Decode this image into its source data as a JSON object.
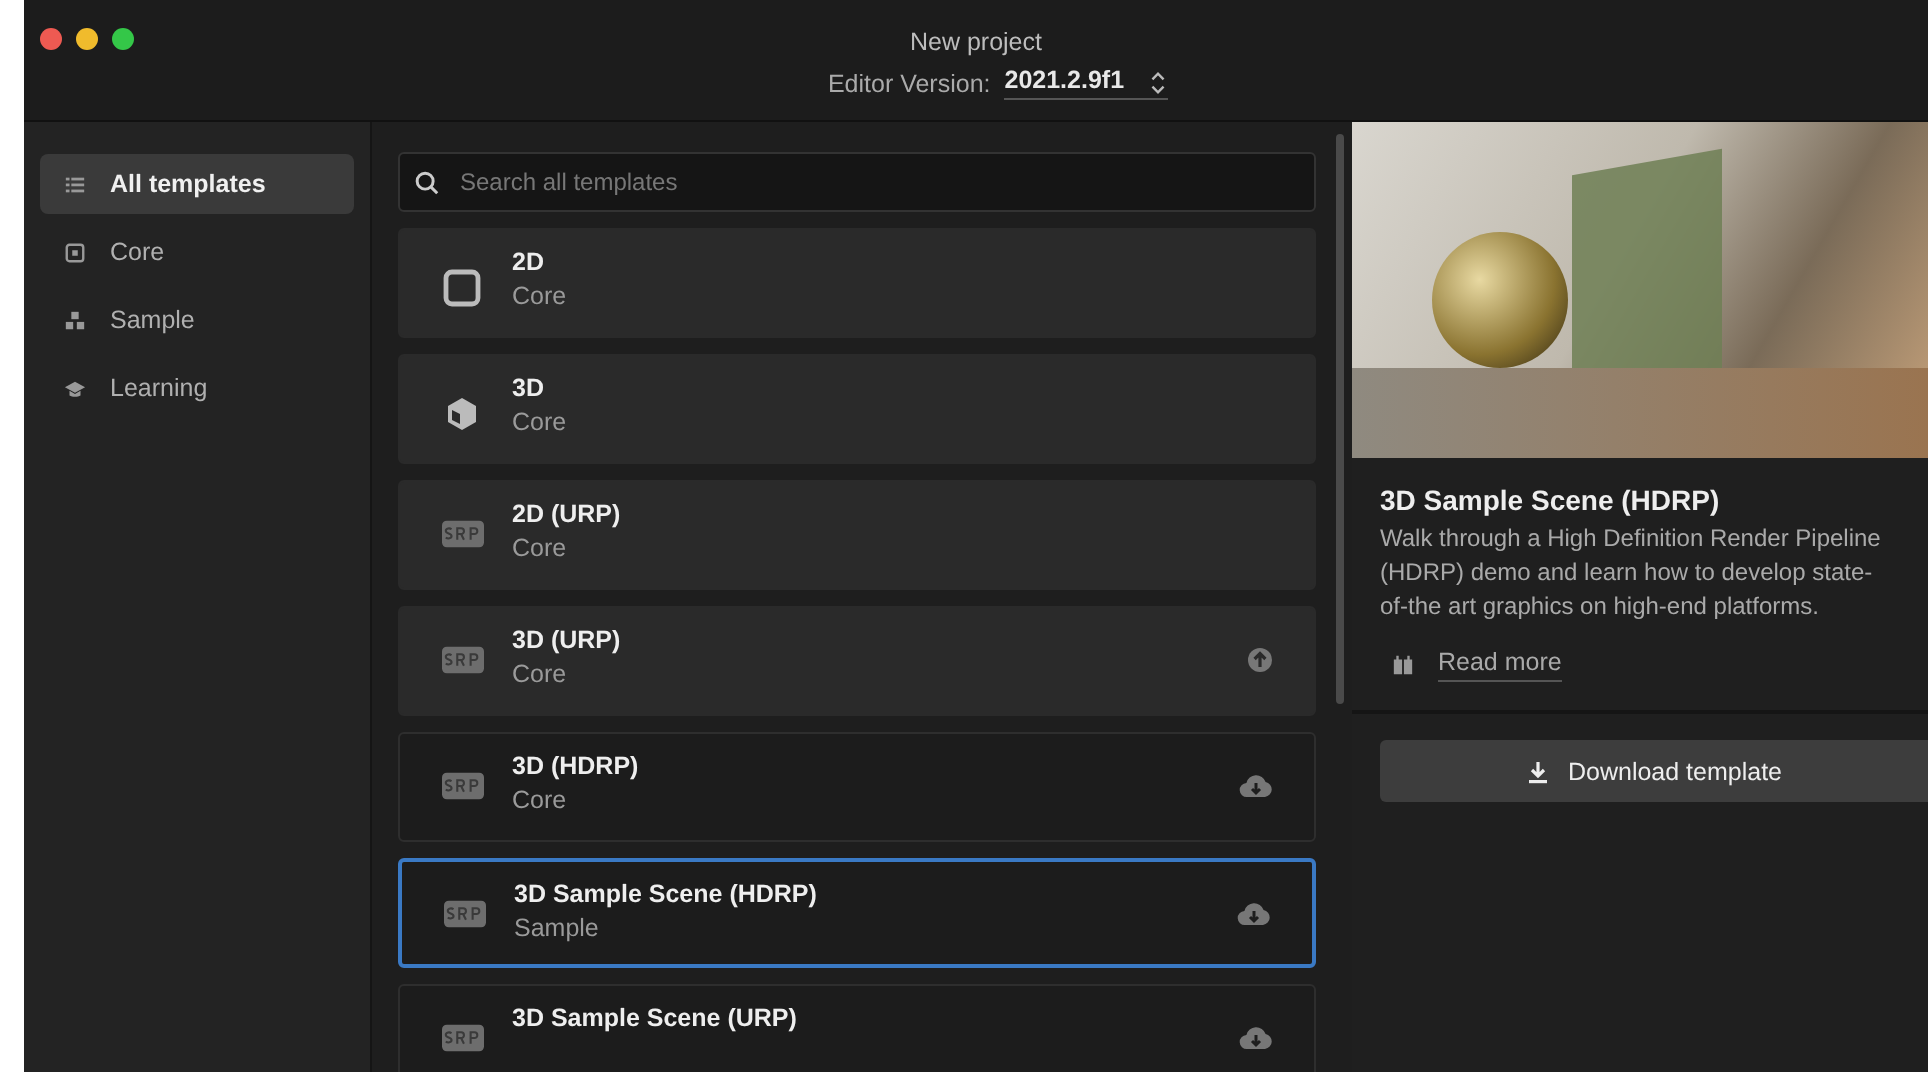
{
  "window": {
    "title": "New project"
  },
  "editor_version": {
    "label": "Editor Version:",
    "value": "2021.2.9f1"
  },
  "sidebar": {
    "items": [
      {
        "label": "All templates",
        "selected": true
      },
      {
        "label": "Core",
        "selected": false
      },
      {
        "label": "Sample",
        "selected": false
      },
      {
        "label": "Learning",
        "selected": false
      }
    ]
  },
  "search": {
    "placeholder": "Search all templates"
  },
  "templates": [
    {
      "name": "2D",
      "category": "Core",
      "kind": "square",
      "downloaded": true,
      "update_available": false,
      "selected": false
    },
    {
      "name": "3D",
      "category": "Core",
      "kind": "cube",
      "downloaded": true,
      "update_available": false,
      "selected": false
    },
    {
      "name": "2D (URP)",
      "category": "Core",
      "kind": "srp",
      "downloaded": true,
      "update_available": false,
      "selected": false
    },
    {
      "name": "3D (URP)",
      "category": "Core",
      "kind": "srp",
      "downloaded": true,
      "update_available": true,
      "selected": false
    },
    {
      "name": "3D (HDRP)",
      "category": "Core",
      "kind": "srp",
      "downloaded": false,
      "update_available": false,
      "selected": false
    },
    {
      "name": "3D Sample Scene (HDRP)",
      "category": "Sample",
      "kind": "srp",
      "downloaded": false,
      "update_available": false,
      "selected": true
    },
    {
      "name": "3D Sample Scene (URP)",
      "kind": "srp",
      "downloaded": false,
      "update_available": false,
      "selected": false
    }
  ],
  "detail": {
    "title": "3D Sample Scene (HDRP)",
    "description": "Walk through a High Definition Render Pipeline (HDRP) demo and learn how to develop state-of-the art graphics on high-end platforms.",
    "read_more": "Read more",
    "button": "Download template"
  }
}
